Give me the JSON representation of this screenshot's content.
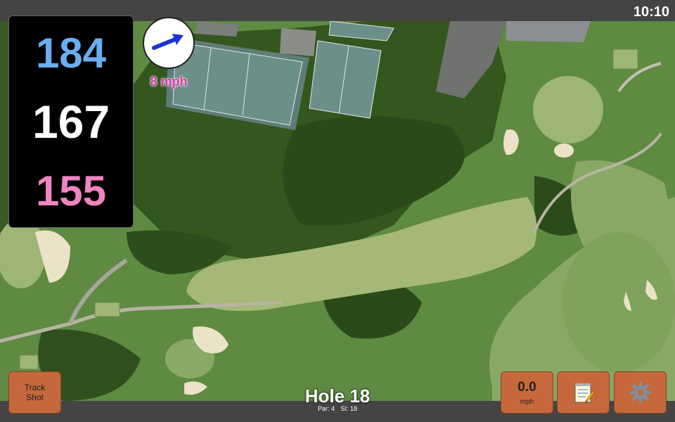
{
  "status": {
    "time": "10:10"
  },
  "yardages": {
    "back": "184",
    "middle": "167",
    "front": "155"
  },
  "wind": {
    "speed_label": "8 mph",
    "icon": "arrow-icon"
  },
  "buttons": {
    "track_shot_line1": "Track",
    "track_shot_line2": "Shot",
    "speed_value": "0.0",
    "speed_unit": "mph",
    "notes_icon": "notepad-icon",
    "settings_icon": "gear-icon"
  },
  "hole": {
    "title": "Hole 18",
    "par": "Par: 4",
    "si": "SI: 18"
  },
  "colors": {
    "back_yardage": "#6aaef0",
    "front_yardage": "#ef84c2",
    "button": "#c6683c"
  }
}
